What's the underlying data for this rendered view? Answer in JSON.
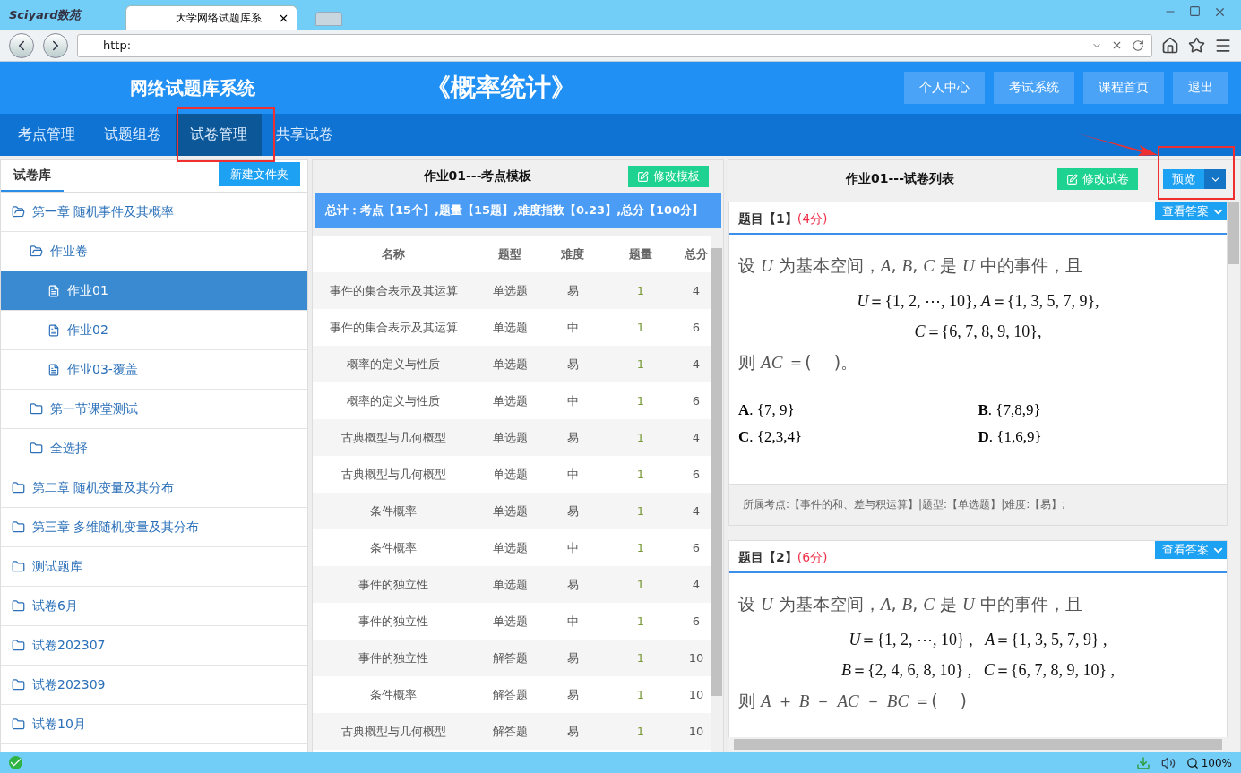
{
  "browser": {
    "logo": "Sciyard数苑",
    "tab_title": "大学网络试题库系",
    "url": "http:",
    "zoom": "100%"
  },
  "header": {
    "system_name": "网络试题库系统",
    "course_title": "《概率统计》",
    "buttons": [
      "个人中心",
      "考试系统",
      "课程首页",
      "退出"
    ]
  },
  "nav": [
    {
      "label": "考点管理",
      "selected": false
    },
    {
      "label": "试题组卷",
      "selected": false
    },
    {
      "label": "试卷管理",
      "selected": true
    },
    {
      "label": "共享试卷",
      "selected": false
    }
  ],
  "library": {
    "tabs": [
      {
        "label": "试卷库",
        "selected": true
      }
    ],
    "new_folder_button": "新建文件夹",
    "tree": [
      {
        "label": "第一章 随机事件及其概率",
        "kind": "folder",
        "expanded": true,
        "selected": false,
        "children": [
          {
            "label": "作业卷",
            "kind": "folder",
            "expanded": true,
            "selected": false,
            "children": [
              {
                "label": "作业01",
                "kind": "file",
                "selected": true
              },
              {
                "label": "作业02",
                "kind": "file",
                "selected": false
              },
              {
                "label": "作业03-覆盖",
                "kind": "file",
                "selected": false
              }
            ]
          },
          {
            "label": "第一节课堂测试",
            "kind": "folder",
            "expanded": false,
            "selected": false
          },
          {
            "label": "全选择",
            "kind": "folder",
            "expanded": false,
            "selected": false
          }
        ]
      },
      {
        "label": "第二章 随机变量及其分布",
        "kind": "folder",
        "expanded": false,
        "selected": false
      },
      {
        "label": "第三章 多维随机变量及其分布",
        "kind": "folder",
        "expanded": false,
        "selected": false
      },
      {
        "label": "测试题库",
        "kind": "folder",
        "expanded": false,
        "selected": false
      },
      {
        "label": "试卷6月",
        "kind": "folder",
        "expanded": false,
        "selected": false
      },
      {
        "label": "试卷202307",
        "kind": "folder",
        "expanded": false,
        "selected": false
      },
      {
        "label": "试卷202309",
        "kind": "folder",
        "expanded": false,
        "selected": false
      },
      {
        "label": "试卷10月",
        "kind": "folder",
        "expanded": false,
        "selected": false
      }
    ]
  },
  "template": {
    "title": "作业01---考点模板",
    "edit_button": "修改模板",
    "summary": "总计：考点【15个】,题量【15题】,难度指数【0.23】,总分【100分】",
    "columns": [
      "名称",
      "题型",
      "难度",
      "题量",
      "总分"
    ],
    "rows": [
      [
        "事件的集合表示及其运算",
        "单选题",
        "易",
        "1",
        "4"
      ],
      [
        "事件的集合表示及其运算",
        "单选题",
        "中",
        "1",
        "6"
      ],
      [
        "概率的定义与性质",
        "单选题",
        "易",
        "1",
        "4"
      ],
      [
        "概率的定义与性质",
        "单选题",
        "中",
        "1",
        "6"
      ],
      [
        "古典概型与几何概型",
        "单选题",
        "易",
        "1",
        "4"
      ],
      [
        "古典概型与几何概型",
        "单选题",
        "中",
        "1",
        "6"
      ],
      [
        "条件概率",
        "单选题",
        "易",
        "1",
        "4"
      ],
      [
        "条件概率",
        "单选题",
        "中",
        "1",
        "6"
      ],
      [
        "事件的独立性",
        "单选题",
        "易",
        "1",
        "4"
      ],
      [
        "事件的独立性",
        "单选题",
        "中",
        "1",
        "6"
      ],
      [
        "事件的独立性",
        "解答题",
        "易",
        "1",
        "10"
      ],
      [
        "条件概率",
        "解答题",
        "易",
        "1",
        "10"
      ],
      [
        "古典概型与几何概型",
        "解答题",
        "易",
        "1",
        "10"
      ]
    ]
  },
  "paper": {
    "title": "作业01---试卷列表",
    "edit_button": "修改试卷",
    "preview_button": "预览",
    "questions": [
      {
        "label": "题目【1】",
        "score": "(4分)",
        "answer_button": "查看答案",
        "stem": "设 *U* 为基本空间，*A*, *B*, *C* 是 *U* 中的事件，且",
        "formulas": [
          "*U*＝{1, 2, ⋯, 10}, *A*＝{1, 3, 5, 7, 9},",
          "*C*＝{6, 7, 8, 9, 10},"
        ],
        "tail": "则 *AC* ＝(　 )。",
        "options": [
          "**A**. {7, 9}",
          "**B**. {7,8,9}",
          "**C**. {2,3,4}",
          "**D**. {1,6,9}"
        ],
        "footer": "所属考点:【事件的和、差与积运算】|题型:【单选题】|难度:【易】;"
      },
      {
        "label": "题目【2】",
        "score": "(6分)",
        "answer_button": "查看答案",
        "stem": "设 *U* 为基本空间，*A*, *B*, *C* 是 *U* 中的事件，且",
        "formulas": [
          "*U*＝{1, 2, ⋯, 10} ,   *A*＝{1, 3, 5, 7, 9} ,",
          "*B*＝{2, 4, 6, 8, 10} ,   *C*＝{6, 7, 8, 9, 10} ,"
        ],
        "tail": "则 *A* ＋ *B* － *AC* － *BC* ＝(　 )"
      }
    ]
  }
}
